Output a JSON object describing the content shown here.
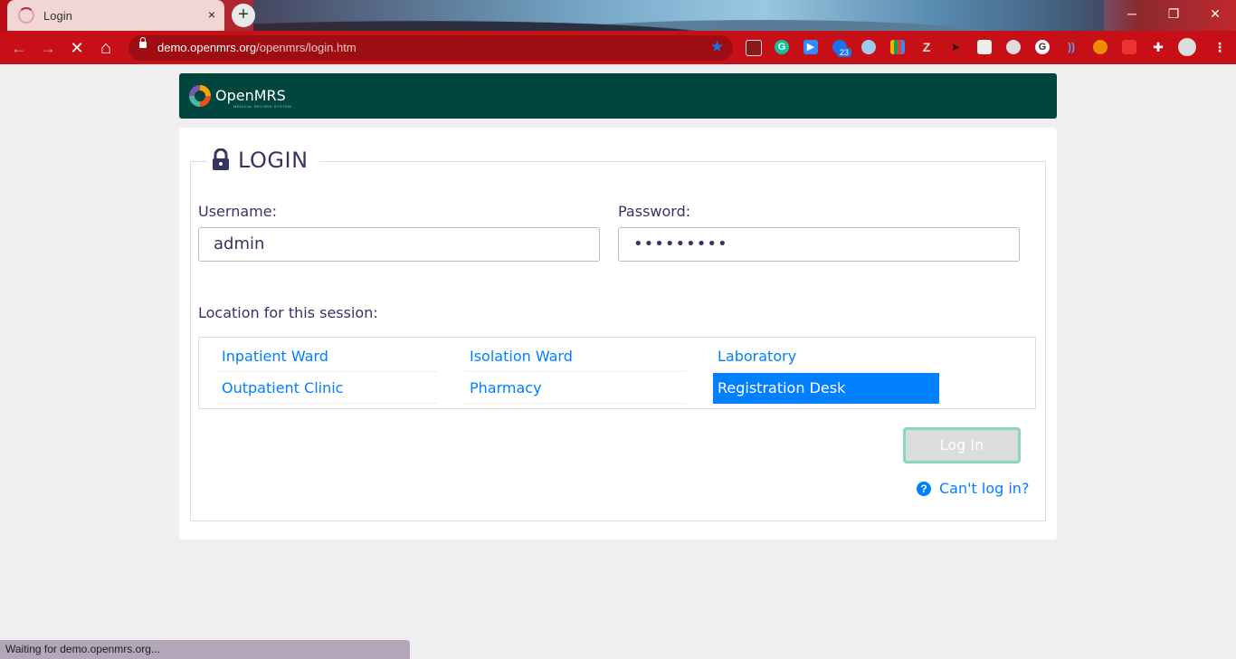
{
  "browser": {
    "tab_title": "Login",
    "tab_close": "×",
    "new_tab": "+",
    "url_host": "demo.openmrs.org",
    "url_path": "/openmrs/login.htm",
    "window_controls": {
      "minimize": "─",
      "restore": "❐",
      "close": "✕"
    },
    "nav": {
      "back": "←",
      "forward": "→",
      "stop": "✕",
      "home": "⌂"
    },
    "extension_badge": "23",
    "status_text": "Waiting for demo.openmrs.org..."
  },
  "header": {
    "logo_text": "OpenMRS",
    "logo_subtext": "MEDICAL RECORD SYSTEM"
  },
  "login": {
    "title": "LOGIN",
    "username_label": "Username:",
    "username_value": "admin",
    "password_label": "Password:",
    "password_value": "•••••••••",
    "location_label": "Location for this session:",
    "locations": [
      {
        "label": "Inpatient Ward",
        "selected": false
      },
      {
        "label": "Isolation Ward",
        "selected": false
      },
      {
        "label": "Laboratory",
        "selected": false
      },
      {
        "label": "Outpatient Clinic",
        "selected": false
      },
      {
        "label": "Pharmacy",
        "selected": false
      },
      {
        "label": "Registration Desk",
        "selected": true
      }
    ],
    "login_button": "Log In",
    "help_icon": "?",
    "help_link": "Can't log in?"
  },
  "colors": {
    "header_bg": "#00463f",
    "accent": "#007fff",
    "text": "#363463",
    "browser_red": "#c60f16",
    "button_border": "#88d9b6"
  }
}
